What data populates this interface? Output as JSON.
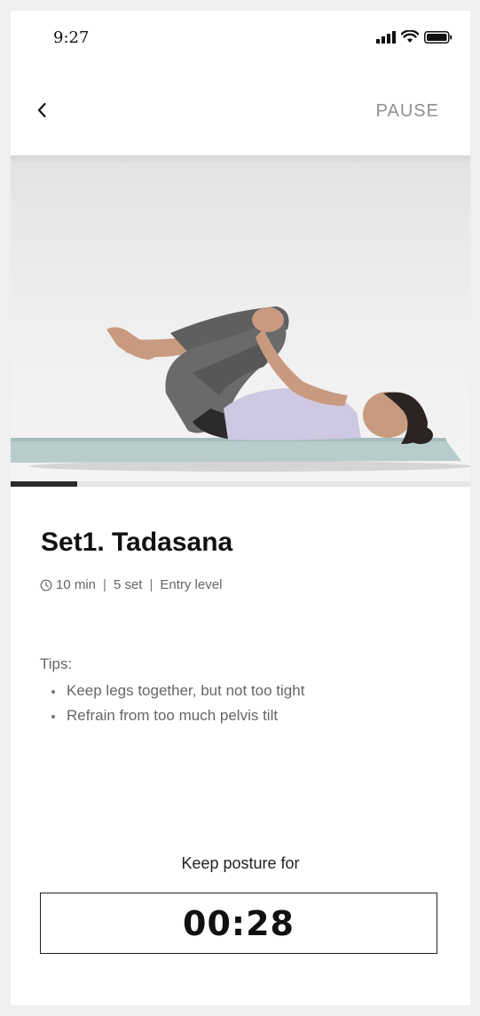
{
  "status_bar": {
    "time": "9:27",
    "icons": [
      "signal-icon",
      "wifi-icon",
      "battery-icon"
    ]
  },
  "header": {
    "back_icon": "chevron-left-icon",
    "pause_label": "PAUSE"
  },
  "video": {
    "subject": "yoga pose on mat",
    "progress": 0.145
  },
  "exercise": {
    "title": "Set1. Tadasana",
    "duration_icon": "clock-icon",
    "duration": "10 min",
    "sets": "5 set",
    "level": "Entry level",
    "separator": "|"
  },
  "tips": {
    "label": "Tips:",
    "items": [
      "Keep legs together, but not too tight",
      "Refrain from too much pelvis tilt"
    ]
  },
  "timer": {
    "label": "Keep posture for",
    "value": "00:28"
  },
  "colors": {
    "background": "#ffffff",
    "text_primary": "#111111",
    "text_secondary": "#666666",
    "accent_dark": "#2b2b2b",
    "pause_text": "#8f8f8f"
  }
}
